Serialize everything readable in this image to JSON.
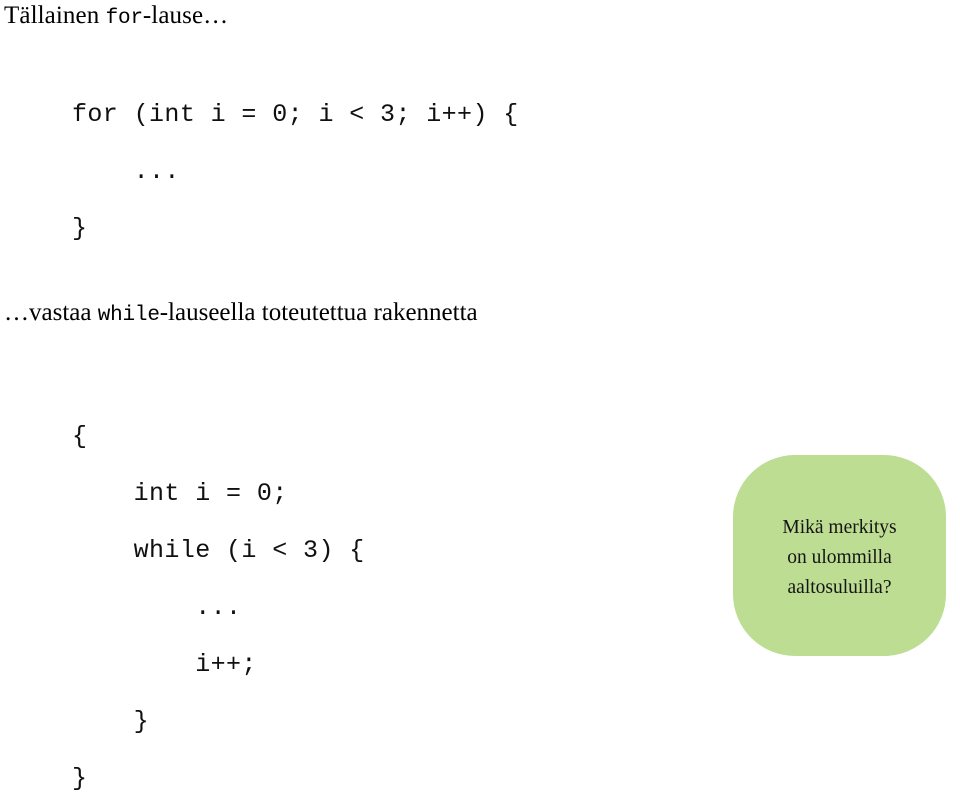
{
  "slide": {
    "background_color": "#ffffff",
    "text_color": "#000000"
  },
  "title": {
    "prefix": "Tällainen ",
    "keyword": "for",
    "suffix": "-lause…"
  },
  "code_block_1": {
    "language": "java",
    "lines": [
      "for (int i = 0; i < 3; i++) {",
      "    ...",
      "}"
    ]
  },
  "prose": {
    "prefix": "…vastaa ",
    "keyword": "while",
    "suffix": "-lauseella toteutettua rakennetta"
  },
  "code_block_2": {
    "language": "java",
    "lines": [
      "{",
      "    int i = 0;",
      "    while (i < 3) {",
      "        ...",
      "        i++;",
      "    }",
      "}"
    ]
  },
  "callout": {
    "background_color": "#bcdd92",
    "lines": [
      "Mikä merkitys",
      "on ulommilla",
      "aaltosuluilla?"
    ]
  }
}
